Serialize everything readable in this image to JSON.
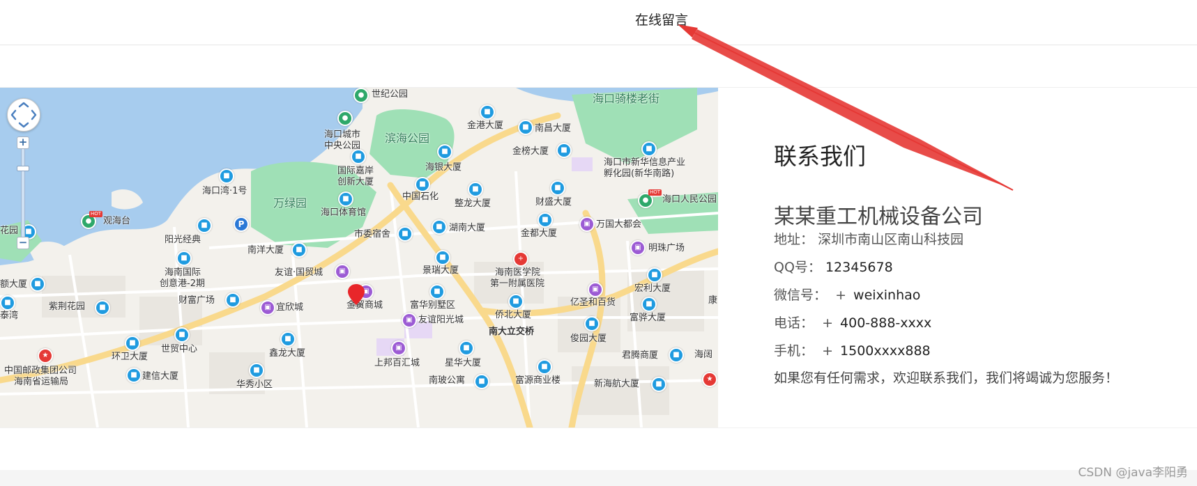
{
  "nav": {
    "online_message": "在线留言"
  },
  "map": {
    "labels": {
      "century_park": "世纪公园",
      "haikou_qilou": "海口骑楼老街",
      "city_central_park_1": "海口城市",
      "city_central_park_2": "中央公园",
      "binhai_park": "滨海公园",
      "jingang": "金港大厦",
      "nanchang": "南昌大厦",
      "jinbang": "金榜大厦",
      "haiyin": "海银大厦",
      "newchina_1": "海口市新华信息产业",
      "newchina_2": "孵化园(新华南路)",
      "intl_1": "国际嘉岸",
      "intl_2": "创新大厦",
      "haikouwan": "海口湾·1号",
      "wanlvyuan": "万绿园",
      "sinopec": "中国石化",
      "zhenglong": "整龙大厦",
      "caisheng": "财盛大厦",
      "peoples_park": "海口人民公园",
      "guanhaitai": "观海台",
      "stadium": "海口体育馆",
      "shiwei": "市委宿舍",
      "hunan": "湖南大厦",
      "jindu": "金都大厦",
      "wanguo": "万国大都会",
      "huayuan": "花园",
      "yangguang": "阳光经典",
      "nanyang": "南洋大厦",
      "mingzhu": "明珠广场",
      "youyi_guomao": "友谊·国贸城",
      "jingrui": "景瑞大厦",
      "hospital_1": "海南医学院",
      "hospital_2": "第一附属医院",
      "hainan_intl_1": "海南国际",
      "hainan_intl_2": "创意港-2期",
      "hongli": "宏利大厦",
      "building_left": "额大厦",
      "caifu": "财富广场",
      "jinmao": "金贸商城",
      "fuhua": "富华别墅区",
      "yisheng": "亿圣和百货",
      "kang": "康",
      "zijing": "紫荆花园",
      "yixin": "宜欣城",
      "qiaobei": "侨北大厦",
      "fuhua_d": "富骅大厦",
      "tai": "泰湾",
      "youyi_yg": "友谊阳光城",
      "nanda": "南大立交桥",
      "junyuan": "俊园大厦",
      "shimao": "世贸中心",
      "huanwei": "环卫大厦",
      "xinlong": "鑫龙大厦",
      "shangbang": "上邦百汇城",
      "xinghua": "星华大厦",
      "junteng": "君腾商厦",
      "haige": "海阔",
      "post_1": "中国邮政集团公司",
      "post_2": "海南省运输局",
      "jianxin": "建信大厦",
      "huaxiu": "华秀小区",
      "nanpo": "南玻公寓",
      "fuyuan": "富源商业楼",
      "xinhaihang": "新海航大厦",
      "hot": "HOT"
    }
  },
  "contact": {
    "title": "联系我们",
    "company": "某某重工机械设备公司",
    "address_label": "地址：",
    "address_value": "深圳市南山区南山科技园",
    "qq_label": "QQ号：",
    "qq_value": "12345678",
    "wechat_label": "微信号：",
    "wechat_value": "weixinhao",
    "phone_label": "电话：",
    "phone_value": "400-888-xxxx",
    "mobile_label": "手机：",
    "mobile_value": "1500xxxx888",
    "plus": "+",
    "slogan": "如果您有任何需求，欢迎联系我们，我们将竭诚为您服务！"
  },
  "watermark": "CSDN @java李阳勇",
  "colors": {
    "water": "#a7ccee",
    "park": "#9fe0b6",
    "road_major": "#f9d98c",
    "road_minor": "#ffffff",
    "land": "#f3f1ec",
    "annotation_arrow": "#e53935"
  }
}
